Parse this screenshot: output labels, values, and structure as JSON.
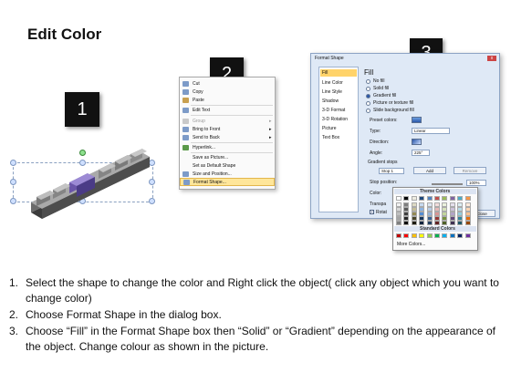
{
  "title": "Edit Color",
  "badges": [
    "1",
    "2",
    "3"
  ],
  "context_menu": {
    "items": [
      {
        "label": "Cut",
        "arrow": false,
        "dim": false
      },
      {
        "label": "Copy",
        "arrow": false,
        "dim": false
      },
      {
        "label": "Paste",
        "arrow": false,
        "dim": false
      },
      {
        "label": "Edit Text",
        "arrow": false,
        "dim": false
      },
      {
        "label": "Group",
        "arrow": true,
        "dim": true
      },
      {
        "label": "Bring to Front",
        "arrow": true,
        "dim": false
      },
      {
        "label": "Send to Back",
        "arrow": true,
        "dim": false
      },
      {
        "label": "Hyperlink...",
        "arrow": false,
        "dim": false
      },
      {
        "label": "Save as Picture...",
        "arrow": false,
        "dim": false
      },
      {
        "label": "Set as Default Shape",
        "arrow": false,
        "dim": false
      },
      {
        "label": "Size and Position...",
        "arrow": false,
        "dim": false
      },
      {
        "label": "Format Shape...",
        "arrow": false,
        "dim": false,
        "highlight": true
      }
    ],
    "arrow_glyph": "▸"
  },
  "dialog": {
    "title": "Format Shape",
    "close": "x",
    "nav": [
      "Fill",
      "Line Color",
      "Line Style",
      "Shadow",
      "3-D Format",
      "3-D Rotation",
      "Picture",
      "Text Box"
    ],
    "heading": "Fill",
    "radios": [
      {
        "label": "No fill",
        "on": false
      },
      {
        "label": "Solid fill",
        "on": false
      },
      {
        "label": "Gradient fill",
        "on": true
      },
      {
        "label": "Picture or texture fill",
        "on": false
      },
      {
        "label": "Slide background fill",
        "on": false
      }
    ],
    "preset_label": "Preset colors:",
    "type_label": "Type:",
    "type_value": "Linear",
    "direction_label": "Direction:",
    "angle_label": "Angle:",
    "angle_value": "225°",
    "gradient_stops_label": "Gradient stops",
    "stop_value": "Stop 1",
    "add_label": "Add",
    "remove_label": "Remove",
    "stop_position_label": "Stop position:",
    "stop_position_value": "100%",
    "color_label": "Color:",
    "transparency_label": "Transpa",
    "rotate_label": "Rotat",
    "close_btn": "Close"
  },
  "palette": {
    "theme_label": "Theme Colors",
    "standard_label": "Standard Colors",
    "more_label": "More Colors...",
    "theme_top": [
      "#ffffff",
      "#000000",
      "#eeece1",
      "#1f497d",
      "#4f81bd",
      "#c0504d",
      "#9bbb59",
      "#8064a2",
      "#4bacc6",
      "#f79646"
    ],
    "theme_shades": [
      [
        "#f2f2f2",
        "#7f7f7f",
        "#ddd9c3",
        "#c6d9f0",
        "#dbe5f1",
        "#f2dcdb",
        "#ebf1dd",
        "#e5e0ec",
        "#dbeef3",
        "#fdeada"
      ],
      [
        "#d8d8d8",
        "#595959",
        "#c4bd97",
        "#8db3e2",
        "#b8cce4",
        "#e5b9b7",
        "#d7e3bc",
        "#ccc1d9",
        "#b7dde8",
        "#fbd5b5"
      ],
      [
        "#bfbfbf",
        "#3f3f3f",
        "#938953",
        "#548dd4",
        "#95b3d7",
        "#d99694",
        "#c3d69b",
        "#b2a2c7",
        "#92cddc",
        "#fac08f"
      ],
      [
        "#a5a5a5",
        "#262626",
        "#494429",
        "#17365d",
        "#366092",
        "#953734",
        "#76923c",
        "#5f497a",
        "#31859b",
        "#e36c09"
      ],
      [
        "#7f7f7f",
        "#0c0c0c",
        "#1d1b10",
        "#0f243e",
        "#244061",
        "#632423",
        "#4f6128",
        "#3f3151",
        "#205867",
        "#974806"
      ]
    ],
    "standard": [
      "#c00000",
      "#ff0000",
      "#ffc000",
      "#ffff00",
      "#92d050",
      "#00b050",
      "#00b0f0",
      "#0070c0",
      "#002060",
      "#7030a0"
    ]
  },
  "steps": [
    {
      "num": "1.",
      "text": "Select the shape to change the color and Right click the object( click any object which you want to change color)"
    },
    {
      "num": "2.",
      "text": "Choose Format Shape in the dialog box."
    },
    {
      "num": "3.",
      "text": "Choose “Fill” in the Format Shape box then “Solid” or “Gradient” depending on the appearance of the object. Change colour as shown in the picture."
    }
  ]
}
